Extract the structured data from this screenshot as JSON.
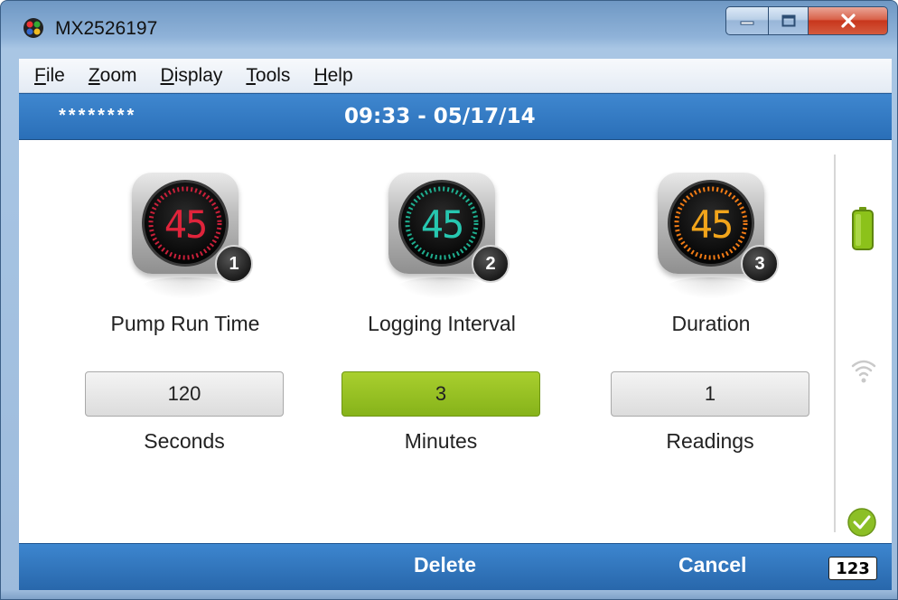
{
  "window": {
    "title": "MX2526197",
    "icons": {
      "app": "app-logo-icon",
      "minimize": "minimize-icon",
      "maximize": "maximize-icon",
      "close": "close-icon"
    }
  },
  "menu": {
    "items": [
      {
        "accel": "F",
        "rest": "ile"
      },
      {
        "accel": "Z",
        "rest": "oom"
      },
      {
        "accel": "D",
        "rest": "isplay"
      },
      {
        "accel": "T",
        "rest": "ools"
      },
      {
        "accel": "H",
        "rest": "elp"
      }
    ]
  },
  "status": {
    "masked": "********",
    "datetime": "09:33 - 05/17/14"
  },
  "gauges": [
    {
      "digits": "45",
      "digit_color": "#e0243b",
      "ring_color": "#c9203a",
      "badge": "1",
      "label": "Pump Run Time",
      "value": "120",
      "unit": "Seconds",
      "selected": false
    },
    {
      "digits": "45",
      "digit_color": "#27c7b0",
      "ring_color": "#1fae8f",
      "badge": "2",
      "label": "Logging Interval",
      "value": "3",
      "unit": "Minutes",
      "selected": true
    },
    {
      "digits": "45",
      "digit_color": "#f2a51b",
      "ring_color": "#f07b16",
      "badge": "3",
      "label": "Duration",
      "value": "1",
      "unit": "Readings",
      "selected": false
    }
  ],
  "side_icons": {
    "battery": "battery-icon",
    "signal": "wifi-signal-icon",
    "status": "check-icon"
  },
  "actions": {
    "delete": "Delete",
    "cancel": "Cancel",
    "keyboard": "123"
  },
  "colors": {
    "accent_blue": "#2a6fb8",
    "selected_green": "#86b31a",
    "battery_green": "#8cc21a"
  }
}
